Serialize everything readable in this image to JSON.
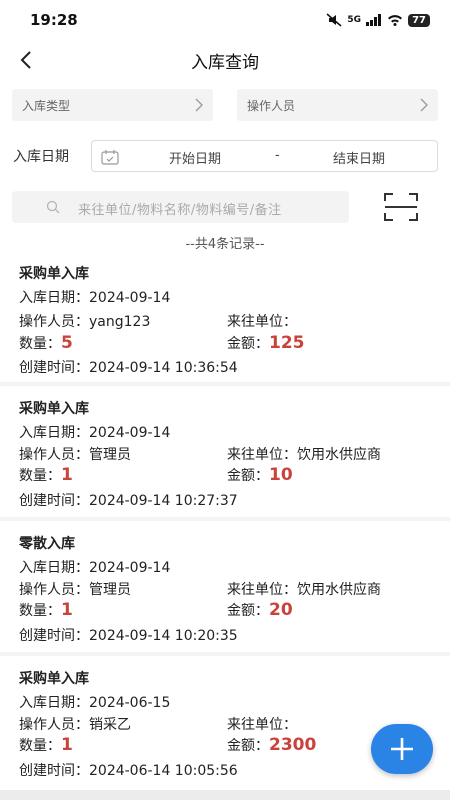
{
  "status": {
    "time": "19:28",
    "network": "5G",
    "battery": "77"
  },
  "nav": {
    "title": "入库查询"
  },
  "filters": {
    "type_label": "入库类型",
    "operator_label": "操作人员"
  },
  "date": {
    "label": "入库日期",
    "start": "开始日期",
    "separator": "-",
    "end": "结束日期"
  },
  "search": {
    "placeholder": "来往单位/物料名称/物料编号/备注"
  },
  "summary": "--共4条记录--",
  "labels": {
    "date": "入库日期：",
    "operator": "操作人员：",
    "partner": "来往单位：",
    "qty": "数量：",
    "amount": "金额：",
    "created": "创建时间："
  },
  "records": [
    {
      "type": "采购单入库",
      "date": "2024-09-14",
      "operator": "yang123",
      "partner": "",
      "qty": "5",
      "amount": "125",
      "created": "2024-09-14 10:36:54"
    },
    {
      "type": "采购单入库",
      "date": "2024-09-14",
      "operator": "管理员",
      "partner": "饮用水供应商",
      "qty": "1",
      "amount": "10",
      "created": "2024-09-14 10:27:37"
    },
    {
      "type": "零散入库",
      "date": "2024-09-14",
      "operator": "管理员",
      "partner": "饮用水供应商",
      "qty": "1",
      "amount": "20",
      "created": "2024-09-14 10:20:35"
    },
    {
      "type": "采购单入库",
      "date": "2024-06-15",
      "operator": "销采乙",
      "partner": "",
      "qty": "1",
      "amount": "2300",
      "created": "2024-06-14 10:05:56"
    }
  ],
  "colors": {
    "accent": "#2a84e6",
    "number": "#c9433a"
  }
}
